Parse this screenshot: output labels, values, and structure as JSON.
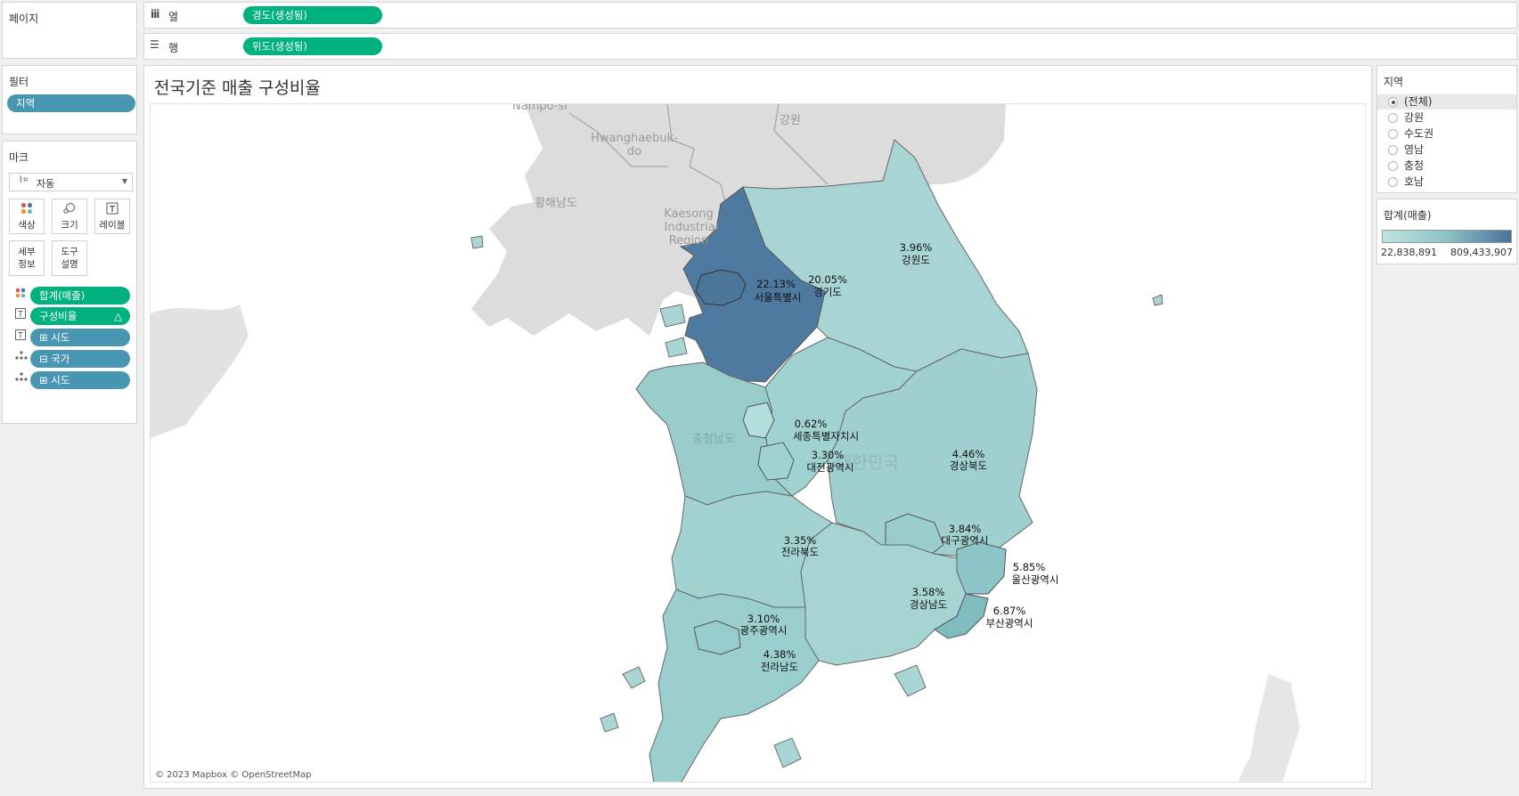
{
  "pages_panel": {
    "title": "페이지"
  },
  "shelves": {
    "columns": {
      "label": "열",
      "pill": "경도(생성됨)"
    },
    "rows": {
      "label": "행",
      "pill": "위도(생성됨)"
    }
  },
  "filters_panel": {
    "title": "필터",
    "pills": [
      "지역"
    ]
  },
  "marks_panel": {
    "title": "마크",
    "mark_type": "자동",
    "buttons": {
      "color": "색상",
      "size": "크기",
      "label": "레이블",
      "detail_1": "세부",
      "detail_2": "정보",
      "tooltip_1": "도구",
      "tooltip_2": "설명"
    },
    "pills": [
      {
        "label": "합계(매출)",
        "color": "#00b180",
        "icon": "color-dots-icon"
      },
      {
        "label": "구성비율",
        "color": "#00b180",
        "icon": "text-label-icon",
        "suffix": "△"
      },
      {
        "label": "시도",
        "color": "#4996b2",
        "icon": "text-label-icon",
        "prefix": "⊞"
      },
      {
        "label": "국가",
        "color": "#4996b2",
        "icon": "detail-icon",
        "prefix": "⊟"
      },
      {
        "label": "시도",
        "color": "#4996b2",
        "icon": "detail-icon",
        "prefix": "⊞"
      }
    ]
  },
  "sheet": {
    "title": "전국기준 매출 구성비율",
    "attribution": "© 2023 Mapbox © OpenStreetMap",
    "basemap_labels": [
      "Nampo-si",
      "강원",
      "Hwanghaebuk-",
      "do",
      "황해남도",
      "Kaesong",
      "Industrial",
      "Region",
      "충청남도",
      "대한민국"
    ],
    "regions": [
      {
        "name": "서울특별시",
        "pct": "22.13%"
      },
      {
        "name": "경기도",
        "pct": "20.05%"
      },
      {
        "name": "강원도",
        "pct": "3.96%"
      },
      {
        "name": "세종특별자치시",
        "pct": "0.62%"
      },
      {
        "name": "대전광역시",
        "pct": "3.30%"
      },
      {
        "name": "경상북도",
        "pct": "4.46%"
      },
      {
        "name": "대구광역시",
        "pct": "3.84%"
      },
      {
        "name": "전라북도",
        "pct": "3.35%"
      },
      {
        "name": "울산광역시",
        "pct": "5.85%"
      },
      {
        "name": "경상남도",
        "pct": "3.58%"
      },
      {
        "name": "부산광역시",
        "pct": "6.87%"
      },
      {
        "name": "광주광역시",
        "pct": "3.10%"
      },
      {
        "name": "전라남도",
        "pct": "4.38%"
      }
    ]
  },
  "region_filter": {
    "title": "지역",
    "options": [
      "(전체)",
      "강원",
      "수도권",
      "영남",
      "충청",
      "호남"
    ],
    "selected": "(전체)"
  },
  "color_legend": {
    "title": "합계(매출)",
    "min": "22,838,891",
    "max": "809,433,907",
    "color_low": "#bfe3df",
    "color_high": "#4a7199"
  },
  "colors": {
    "accent_green": "#00b180",
    "accent_blue": "#4996b2",
    "dark_region": "#4f7a9f",
    "light_region": "#a9d6d4"
  }
}
